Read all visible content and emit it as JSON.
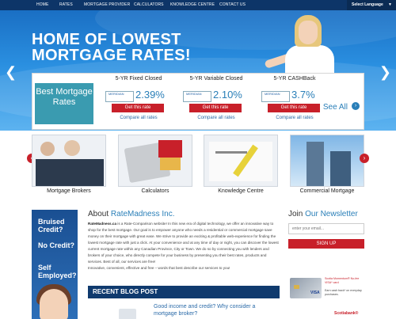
{
  "nav": {
    "items": [
      "HOME",
      "RATES",
      "MORTGAGE PROVIDER",
      "CALCULATORS",
      "KNOWLEDGE CENTRE",
      "CONTACT US"
    ],
    "language": "Select Language"
  },
  "hero": {
    "title_line1": "HOME OF LOWEST",
    "title_line2": "MORTGAGE RATES!",
    "prev_arrow": "❮",
    "next_arrow": "❯"
  },
  "rates": {
    "best_label": "Best Mortgage Rates",
    "columns": [
      {
        "heading": "5-YR Fixed Closed",
        "lender": "MERIDIAN",
        "rate": "2.39%",
        "button": "Get this rate",
        "compare": "Compare all rates"
      },
      {
        "heading": "5-YR Variable Closed",
        "lender": "MERIDIAN",
        "rate": "2.10%",
        "button": "Get this rate",
        "compare": "Compare all rates"
      },
      {
        "heading": "5-YR CASHBack",
        "lender": "MERIDIAN",
        "rate": "3.7%",
        "button": "Get this rate",
        "compare": "Compare all rates"
      }
    ],
    "see_all": "See All",
    "see_all_arrow": "›"
  },
  "tiles": [
    {
      "label": "Mortgage Brokers"
    },
    {
      "label": "Calculators"
    },
    {
      "label": "Knowledge Centre"
    },
    {
      "label": "Commercial Mortgage"
    }
  ],
  "tile_arrows": {
    "left": "‹",
    "right": "›"
  },
  "left_banner": {
    "items": [
      "Bruised Credit?",
      "No Credit?",
      "Self Employed?"
    ]
  },
  "about": {
    "title_prefix": "About ",
    "title_brand": "RateMadness Inc.",
    "brand_bold": "RateMadness.ca",
    "paragraph": " is a Rate-Comparison website! In this new era of digital technology, we offer an innovative way to shop for the best mortgage. Our goal is to empower anyone who needs a residential or commercial mortgage save money on their mortgage with great ease. We strive to provide an exciting & profitable web-experience for finding the lowest mortgage rate with just a click. At your convenience and at any time of day or night, you can discover the lowest current mortgage rate within any Canadian Province, City or Town. We do so by connecting you with lenders and brokers of your choice, who directly compete for your business by presenting you their best rates, products and services. Best of all, our services are free!",
    "tagline": "Innovative, convenient, effective and free – words that best describe our services to you!"
  },
  "blog": {
    "title": "RECENT BLOG POST",
    "post_link": "Good income and credit? Why consider a mortgage broker?"
  },
  "newsletter": {
    "title_prefix": "Join ",
    "title_accent": "Our Newsletter",
    "placeholder": "enter your email...",
    "button": "SIGN UP"
  },
  "ad": {
    "line1": "Scotia Momentum® No-fee VISA* card",
    "line2": "Earn cash back* on everyday purchases.",
    "visa": "VISA",
    "bank": "Scotiabank®"
  },
  "colors": {
    "nav_bg": "#0d3568",
    "accent_red": "#c8202a",
    "accent_blue": "#2a7fb8",
    "best_rates_bg": "#3a9bb0"
  }
}
